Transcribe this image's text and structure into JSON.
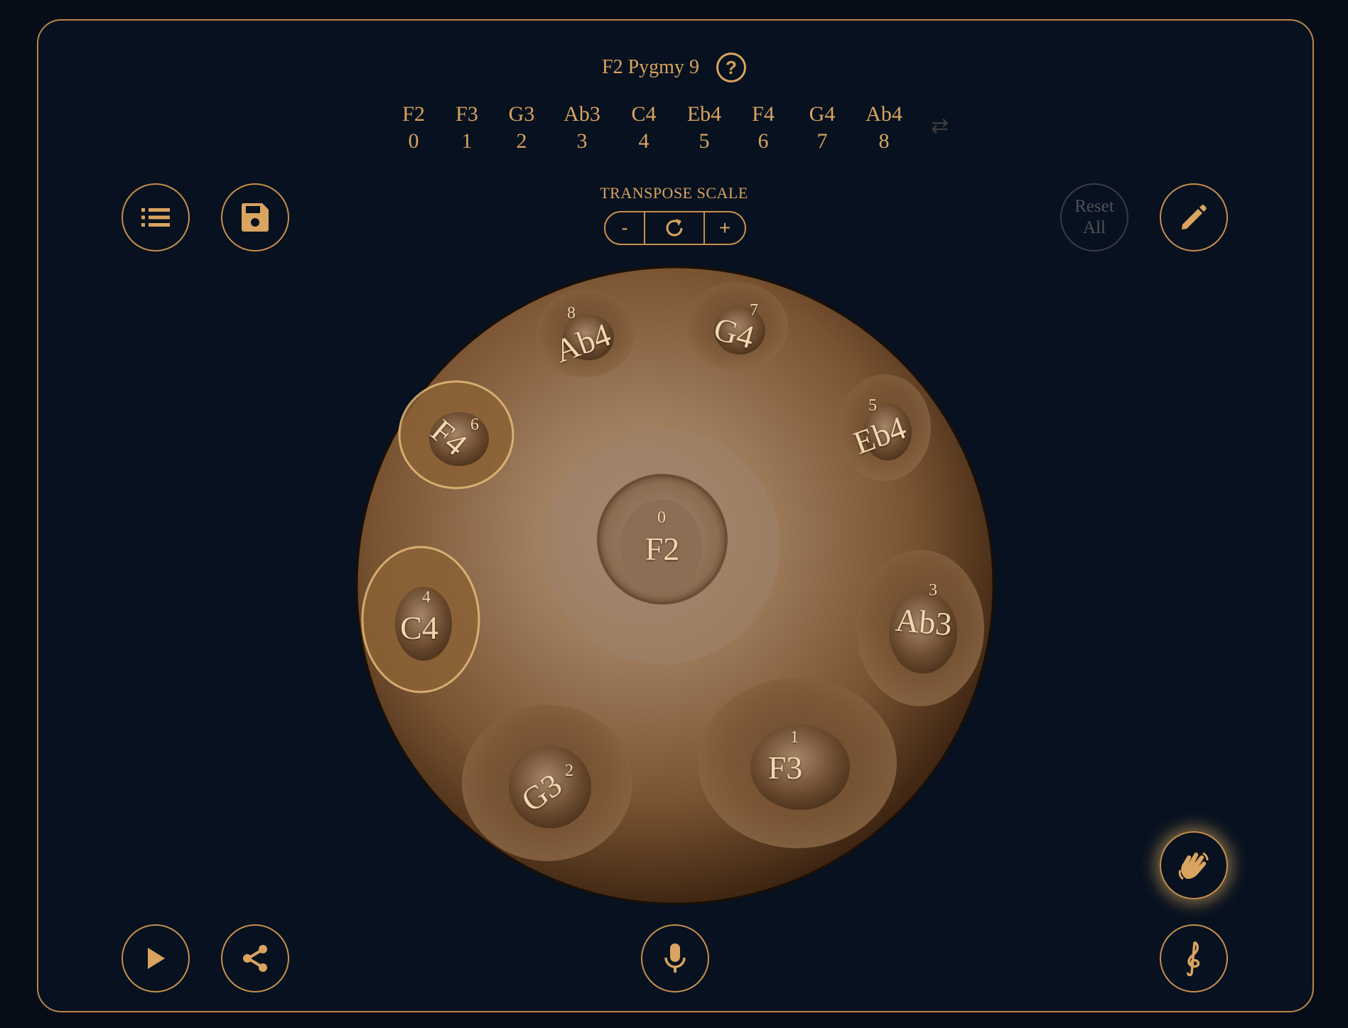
{
  "header": {
    "scale_name": "F2 Pygmy 9",
    "help_icon": "question-circle-icon"
  },
  "scale_notes": [
    {
      "name": "F2",
      "index": "0"
    },
    {
      "name": "F3",
      "index": "1"
    },
    {
      "name": "G3",
      "index": "2"
    },
    {
      "name": "Ab3",
      "index": "3"
    },
    {
      "name": "C4",
      "index": "4"
    },
    {
      "name": "Eb4",
      "index": "5"
    },
    {
      "name": "F4",
      "index": "6"
    },
    {
      "name": "G4",
      "index": "7"
    },
    {
      "name": "Ab4",
      "index": "8"
    }
  ],
  "swap_icon": "swap-arrows-icon",
  "toolbar": {
    "list_icon": "list-icon",
    "save_icon": "save-disk-icon",
    "edit_icon": "pencil-icon",
    "reset_all_line1": "Reset",
    "reset_all_line2": "All"
  },
  "transpose": {
    "label": "TRANSPOSE SCALE",
    "minus": "-",
    "plus": "+",
    "reset_icon": "rotate-icon"
  },
  "handpan": {
    "ding": {
      "name": "F2",
      "index": "0"
    },
    "tone_fields": [
      {
        "name": "F3",
        "index": "1",
        "angle": 0
      },
      {
        "name": "G3",
        "index": "2",
        "angle": -35
      },
      {
        "name": "Ab3",
        "index": "3",
        "angle": 5
      },
      {
        "name": "C4",
        "index": "4",
        "angle": 0
      },
      {
        "name": "Eb4",
        "index": "5",
        "angle": -20
      },
      {
        "name": "F4",
        "index": "6",
        "angle": 40
      },
      {
        "name": "G4",
        "index": "7",
        "angle": 15
      },
      {
        "name": "Ab4",
        "index": "8",
        "angle": -20
      }
    ],
    "highlighted": [
      "4",
      "6"
    ]
  },
  "bottom_bar": {
    "play_icon": "play-icon",
    "share_icon": "share-icon",
    "mic_icon": "microphone-icon",
    "hand_icon": "waving-hands-icon",
    "instrument_icon": "treble-clef-icon"
  },
  "colors": {
    "background": "#070d18",
    "accent": "#d9a45f",
    "border": "#c58f4e",
    "disabled": "#4f5258"
  }
}
